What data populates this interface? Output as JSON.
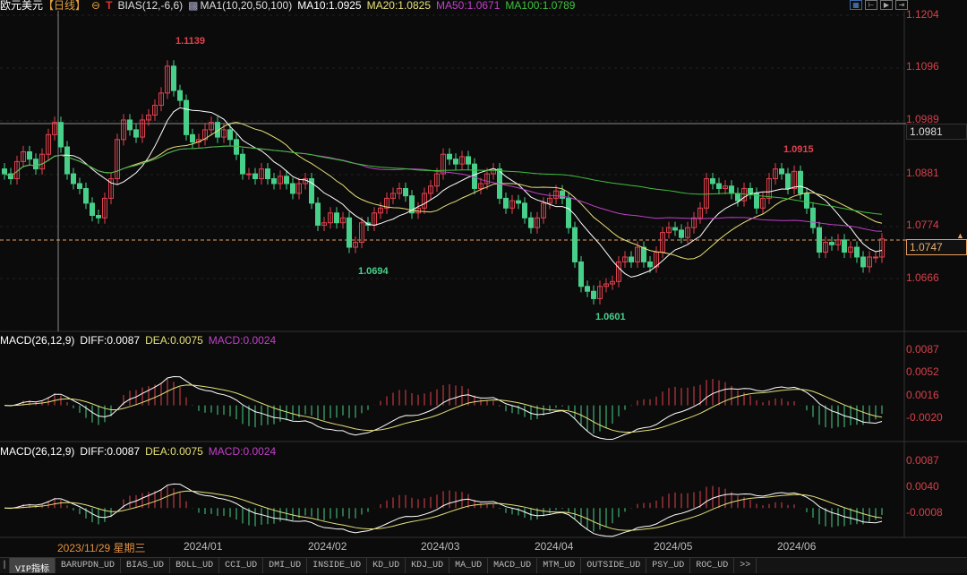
{
  "header": {
    "symbol": "欧元美元",
    "period": "【日线】",
    "indicator": "BIAS(12,-6,6)",
    "ma_label": "MA1(10,20,50,100)",
    "ma10": "MA10:1.0925",
    "ma20": "MA20:1.0825",
    "ma50": "MA50:1.0671",
    "ma100": "MA100:1.0789"
  },
  "colors": {
    "up": "#e0424e",
    "down": "#48d08a",
    "ma10": "#ffffff",
    "ma20": "#e6e07a",
    "ma50": "#c040c8",
    "ma100": "#40c040",
    "axis": "#d6404a"
  },
  "price_axis": [
    "1.1204",
    "1.1096",
    "1.0989",
    "1.0881",
    "1.0774",
    "1.0666"
  ],
  "crosshair_price": "1.0981",
  "current_price": "1.0747",
  "annotations": {
    "high": "1.1139",
    "low1": "1.0694",
    "low2": "1.0601",
    "high2": "1.0915"
  },
  "macd1": {
    "title": "MACD(26,12,9)",
    "diff": "DIFF:0.0087",
    "dea": "DEA:0.0075",
    "macd": "MACD:0.0024",
    "axis": [
      "0.0087",
      "0.0052",
      "0.0016",
      "-0.0020"
    ]
  },
  "macd2": {
    "title": "MACD(26,12,9)",
    "diff": "DIFF:0.0087",
    "dea": "DEA:0.0075",
    "macd": "MACD:0.0024",
    "axis": [
      "0.0087",
      "0.0040",
      "-0.0008"
    ]
  },
  "crosshair_date": "2023/11/29 星期三",
  "dates": [
    "2024/01",
    "2024/02",
    "2024/03",
    "2024/04",
    "2024/05",
    "2024/06"
  ],
  "tabs": [
    "VIP指标",
    "BARUPDN_UD",
    "BIAS_UD",
    "BOLL_UD",
    "CCI_UD",
    "DMI_UD",
    "INSIDE_UD",
    "KD_UD",
    "KDJ_UD",
    "MA_UD",
    "MACD_UD",
    "MTM_UD",
    "OUTSIDE_UD",
    "PSY_UD",
    "ROC_UD",
    ">>"
  ],
  "closes": [
    1.088,
    1.087,
    1.0905,
    1.0925,
    1.091,
    1.089,
    1.092,
    1.096,
    1.0985,
    1.0935,
    1.088,
    1.086,
    1.085,
    1.082,
    1.0795,
    1.079,
    1.083,
    1.087,
    1.095,
    1.099,
    1.097,
    1.0955,
    1.099,
    1.1,
    1.102,
    1.1045,
    1.11,
    1.105,
    1.103,
    1.096,
    1.0945,
    1.095,
    1.097,
    1.0985,
    1.0955,
    1.097,
    1.095,
    1.092,
    1.088,
    1.088,
    1.087,
    1.089,
    1.087,
    1.086,
    1.0875,
    1.086,
    1.084,
    1.086,
    1.087,
    1.082,
    1.0775,
    1.078,
    1.08,
    1.078,
    1.079,
    1.073,
    1.074,
    1.078,
    1.0775,
    1.08,
    1.081,
    1.083,
    1.084,
    1.085,
    1.0835,
    1.08,
    1.081,
    1.084,
    1.0855,
    1.088,
    1.092,
    1.091,
    1.09,
    1.0915,
    1.09,
    1.085,
    1.086,
    1.088,
    1.089,
    1.083,
    1.081,
    1.0825,
    1.082,
    1.079,
    1.077,
    1.079,
    1.082,
    1.083,
    1.0845,
    1.083,
    1.077,
    1.07,
    1.065,
    1.064,
    1.0625,
    1.065,
    1.0655,
    1.066,
    1.07,
    1.071,
    1.07,
    1.073,
    1.07,
    1.069,
    1.072,
    1.076,
    1.077,
    1.0765,
    1.075,
    1.077,
    1.079,
    1.081,
    1.087,
    1.086,
    1.085,
    1.0855,
    1.084,
    1.0825,
    1.085,
    1.084,
    1.081,
    1.083,
    1.087,
    1.089,
    1.088,
    1.085,
    1.0885,
    1.084,
    1.081,
    1.077,
    1.072,
    1.074,
    1.0735,
    1.0745,
    1.072,
    1.073,
    1.071,
    1.069,
    1.071,
    1.071,
    1.0747
  ]
}
